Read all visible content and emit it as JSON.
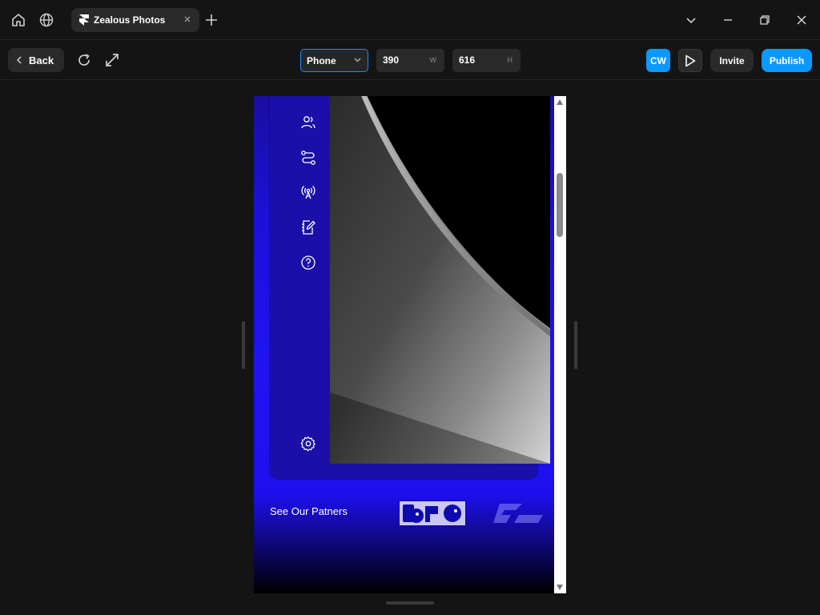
{
  "titlebar": {
    "home_icon": "home-icon",
    "globe_icon": "globe-icon",
    "tab": {
      "title": "Zealous Photos",
      "logo": "framer-logo-icon",
      "close_icon": "close-icon"
    },
    "new_tab_icon": "plus-icon",
    "window_controls": [
      "chevron-down-icon",
      "minimize-icon",
      "restore-icon",
      "close-icon"
    ]
  },
  "toolbar": {
    "back_label": "Back",
    "reload_icon": "reload-icon",
    "expand_icon": "expand-icon",
    "device": {
      "selected": "Phone"
    },
    "width": {
      "value": "390",
      "unit": "W"
    },
    "height": {
      "value": "616",
      "unit": "H"
    },
    "avatar_initials": "CW",
    "play_icon": "play-icon",
    "invite_label": "Invite",
    "publish_label": "Publish",
    "accent_color": "#0b99ff"
  },
  "preview": {
    "sidebar_icons": [
      "users-icon",
      "routes-icon",
      "broadcast-icon",
      "notebook-edit-icon",
      "help-circle-icon",
      "settings-icon"
    ],
    "partners_label": "See Our Patners",
    "background_color": "#1f14f0"
  }
}
